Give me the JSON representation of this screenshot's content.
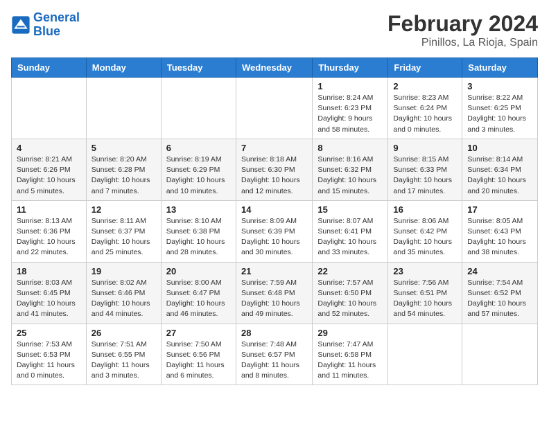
{
  "header": {
    "logo_line1": "General",
    "logo_line2": "Blue",
    "main_title": "February 2024",
    "subtitle": "Pinillos, La Rioja, Spain"
  },
  "days_of_week": [
    "Sunday",
    "Monday",
    "Tuesday",
    "Wednesday",
    "Thursday",
    "Friday",
    "Saturday"
  ],
  "weeks": [
    [
      {
        "day": "",
        "info": ""
      },
      {
        "day": "",
        "info": ""
      },
      {
        "day": "",
        "info": ""
      },
      {
        "day": "",
        "info": ""
      },
      {
        "day": "1",
        "info": "Sunrise: 8:24 AM\nSunset: 6:23 PM\nDaylight: 9 hours\nand 58 minutes."
      },
      {
        "day": "2",
        "info": "Sunrise: 8:23 AM\nSunset: 6:24 PM\nDaylight: 10 hours\nand 0 minutes."
      },
      {
        "day": "3",
        "info": "Sunrise: 8:22 AM\nSunset: 6:25 PM\nDaylight: 10 hours\nand 3 minutes."
      }
    ],
    [
      {
        "day": "4",
        "info": "Sunrise: 8:21 AM\nSunset: 6:26 PM\nDaylight: 10 hours\nand 5 minutes."
      },
      {
        "day": "5",
        "info": "Sunrise: 8:20 AM\nSunset: 6:28 PM\nDaylight: 10 hours\nand 7 minutes."
      },
      {
        "day": "6",
        "info": "Sunrise: 8:19 AM\nSunset: 6:29 PM\nDaylight: 10 hours\nand 10 minutes."
      },
      {
        "day": "7",
        "info": "Sunrise: 8:18 AM\nSunset: 6:30 PM\nDaylight: 10 hours\nand 12 minutes."
      },
      {
        "day": "8",
        "info": "Sunrise: 8:16 AM\nSunset: 6:32 PM\nDaylight: 10 hours\nand 15 minutes."
      },
      {
        "day": "9",
        "info": "Sunrise: 8:15 AM\nSunset: 6:33 PM\nDaylight: 10 hours\nand 17 minutes."
      },
      {
        "day": "10",
        "info": "Sunrise: 8:14 AM\nSunset: 6:34 PM\nDaylight: 10 hours\nand 20 minutes."
      }
    ],
    [
      {
        "day": "11",
        "info": "Sunrise: 8:13 AM\nSunset: 6:36 PM\nDaylight: 10 hours\nand 22 minutes."
      },
      {
        "day": "12",
        "info": "Sunrise: 8:11 AM\nSunset: 6:37 PM\nDaylight: 10 hours\nand 25 minutes."
      },
      {
        "day": "13",
        "info": "Sunrise: 8:10 AM\nSunset: 6:38 PM\nDaylight: 10 hours\nand 28 minutes."
      },
      {
        "day": "14",
        "info": "Sunrise: 8:09 AM\nSunset: 6:39 PM\nDaylight: 10 hours\nand 30 minutes."
      },
      {
        "day": "15",
        "info": "Sunrise: 8:07 AM\nSunset: 6:41 PM\nDaylight: 10 hours\nand 33 minutes."
      },
      {
        "day": "16",
        "info": "Sunrise: 8:06 AM\nSunset: 6:42 PM\nDaylight: 10 hours\nand 35 minutes."
      },
      {
        "day": "17",
        "info": "Sunrise: 8:05 AM\nSunset: 6:43 PM\nDaylight: 10 hours\nand 38 minutes."
      }
    ],
    [
      {
        "day": "18",
        "info": "Sunrise: 8:03 AM\nSunset: 6:45 PM\nDaylight: 10 hours\nand 41 minutes."
      },
      {
        "day": "19",
        "info": "Sunrise: 8:02 AM\nSunset: 6:46 PM\nDaylight: 10 hours\nand 44 minutes."
      },
      {
        "day": "20",
        "info": "Sunrise: 8:00 AM\nSunset: 6:47 PM\nDaylight: 10 hours\nand 46 minutes."
      },
      {
        "day": "21",
        "info": "Sunrise: 7:59 AM\nSunset: 6:48 PM\nDaylight: 10 hours\nand 49 minutes."
      },
      {
        "day": "22",
        "info": "Sunrise: 7:57 AM\nSunset: 6:50 PM\nDaylight: 10 hours\nand 52 minutes."
      },
      {
        "day": "23",
        "info": "Sunrise: 7:56 AM\nSunset: 6:51 PM\nDaylight: 10 hours\nand 54 minutes."
      },
      {
        "day": "24",
        "info": "Sunrise: 7:54 AM\nSunset: 6:52 PM\nDaylight: 10 hours\nand 57 minutes."
      }
    ],
    [
      {
        "day": "25",
        "info": "Sunrise: 7:53 AM\nSunset: 6:53 PM\nDaylight: 11 hours\nand 0 minutes."
      },
      {
        "day": "26",
        "info": "Sunrise: 7:51 AM\nSunset: 6:55 PM\nDaylight: 11 hours\nand 3 minutes."
      },
      {
        "day": "27",
        "info": "Sunrise: 7:50 AM\nSunset: 6:56 PM\nDaylight: 11 hours\nand 6 minutes."
      },
      {
        "day": "28",
        "info": "Sunrise: 7:48 AM\nSunset: 6:57 PM\nDaylight: 11 hours\nand 8 minutes."
      },
      {
        "day": "29",
        "info": "Sunrise: 7:47 AM\nSunset: 6:58 PM\nDaylight: 11 hours\nand 11 minutes."
      },
      {
        "day": "",
        "info": ""
      },
      {
        "day": "",
        "info": ""
      }
    ]
  ]
}
